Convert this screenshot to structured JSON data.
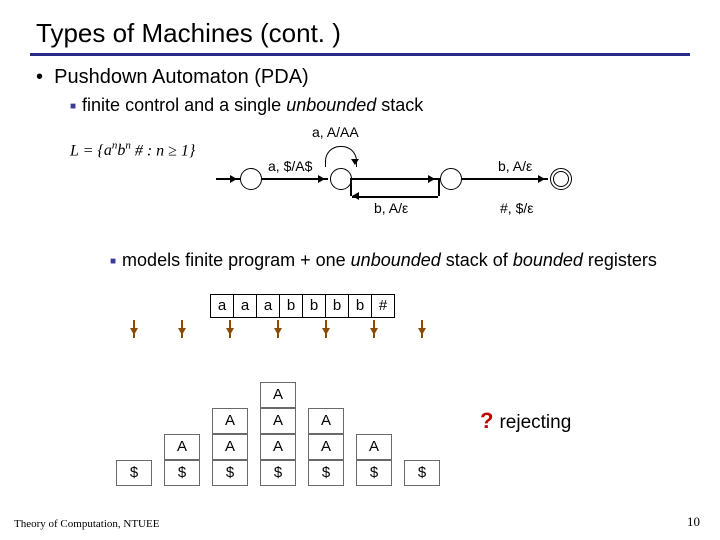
{
  "title": "Types of Machines (cont. )",
  "bullet1": "Pushdown Automaton (PDA)",
  "bullet2_pre": "finite control and a single ",
  "bullet2_em": "unbounded",
  "bullet2_post": " stack",
  "formula_text": "L = { aⁿbⁿ # : n ≥ 1 }",
  "pda": {
    "l_top": "a, A/AA",
    "l_1to2": "a, $/A$",
    "l_2to3": "b, A/ε",
    "l_bot": "b, A/ε",
    "l_3to4": "#, $/ε"
  },
  "bullet3_pre": "models finite program + one ",
  "bullet3_em1": "unbounded",
  "bullet3_mid": " stack of ",
  "bullet3_em2": "bounded",
  "bullet3_post": " registers",
  "tape": [
    "a",
    "a",
    "a",
    "b",
    "b",
    "b",
    "b",
    "#"
  ],
  "stack_cols": [
    {
      "cells": [
        "$"
      ]
    },
    {
      "cells": [
        "A",
        "$"
      ]
    },
    {
      "cells": [
        "A",
        "A",
        "$"
      ]
    },
    {
      "cells": [
        "A",
        "A",
        "A",
        "$"
      ]
    },
    {
      "cells": [
        "A",
        "A",
        "$"
      ]
    },
    {
      "cells": [
        "A",
        "$"
      ]
    },
    {
      "cells": [
        "$"
      ]
    }
  ],
  "reject_label": "rejecting",
  "qmark": "?",
  "footer_left": "Theory of Computation, NTUEE",
  "footer_right": "10"
}
